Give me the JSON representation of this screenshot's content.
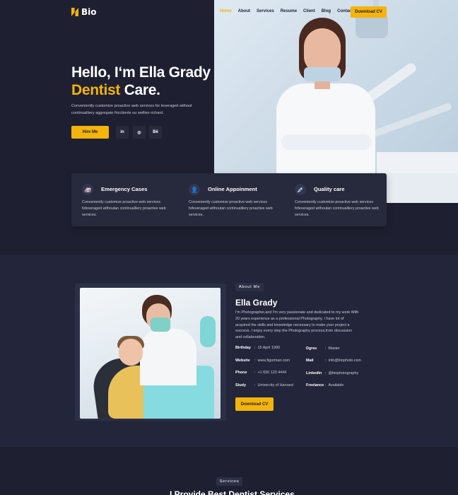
{
  "header": {
    "logo": "Bio",
    "nav": [
      {
        "label": "Home",
        "active": true
      },
      {
        "label": "About",
        "active": false
      },
      {
        "label": "Services",
        "active": false
      },
      {
        "label": "Resume",
        "active": false
      },
      {
        "label": "Client",
        "active": false
      },
      {
        "label": "Blog",
        "active": false
      },
      {
        "label": "Contact",
        "active": false
      }
    ],
    "download_cv": "Download CV"
  },
  "hero": {
    "title_line1": "Hello, I‘m Ella Grady",
    "title_accent": "Dentist",
    "title_rest": " Care.",
    "description": "Conveniently customize proactive web services for leveraged without continualliery aggregate fricctionle ou wellies richard.",
    "hire_button": "Hire Me",
    "social": [
      "in",
      "◎",
      "Bē"
    ]
  },
  "features": [
    {
      "icon": "ambulance-icon",
      "glyph": "🚑",
      "title": "Emergency Cases",
      "desc": "Conveniently customize proactive web services fofeveraged withoutan continualliery proactive web services."
    },
    {
      "icon": "user-icon",
      "glyph": "👤",
      "title": "Online Appoinment",
      "desc": "Conveniently customize proactive web services fofeveraged withoutan continualliery proactive web services."
    },
    {
      "icon": "syringe-icon",
      "glyph": "💉",
      "title": "Quality care",
      "desc": "Conveniently customize proactive web services fofeveraged withoutan continualliery proactive web services."
    }
  ],
  "about": {
    "tag": "About Me",
    "name": "Ella Grady",
    "bio": "I'm Photographer,and I'm very passionate and dedicated to my work With 20 years experience as a professional Photography, I have lot of acquired the skills and knowledge necessary to make your project a success. I enjoy every step the Photography process,from discussion and collaboration.",
    "info_left": [
      {
        "key": "Birthday",
        "value": "15 April 1990"
      },
      {
        "key": "Website",
        "value": "www.figorman.com"
      },
      {
        "key": "Phone",
        "value": "+1 650 123 4444"
      },
      {
        "key": "Study",
        "value": "Univercity of Harvard"
      }
    ],
    "info_right": [
      {
        "key": "Dgree",
        "value": "Master"
      },
      {
        "key": "Mail",
        "value": "info@biophoto.com"
      },
      {
        "key": "Linkedin",
        "value": "@biophotography"
      },
      {
        "key": "Freelance",
        "value": "Available"
      }
    ],
    "download_cv": "Download CV"
  },
  "services": {
    "tag": "Services",
    "title": "I Provide Best Dentist Services"
  },
  "colors": {
    "accent": "#f5b40b",
    "background": "#1e2031",
    "card": "#262a3c"
  }
}
